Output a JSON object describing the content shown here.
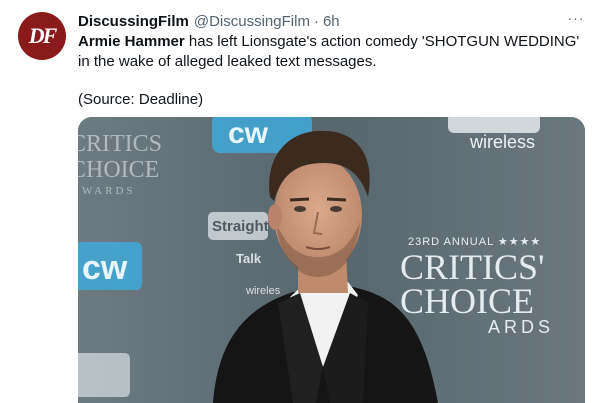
{
  "account": {
    "name": "DiscussingFilm",
    "handle": "@DiscussingFilm",
    "separator": "·",
    "time": "6h",
    "avatar_text": "DF"
  },
  "tweet": {
    "bold_name": "Armie Hammer",
    "text": " has left Lionsgate's action comedy 'SHOTGUN WEDDING' in the wake of alleged leaked text messages.",
    "source": "(Source: Deadline)"
  },
  "more_icon": "···",
  "image": {
    "backdrop_text": {
      "left_critics": "CRITICS",
      "left_choice": "CHOICE",
      "left_awards": "WARDS",
      "cw": "cw",
      "cw_top": "cw",
      "straight_talk": "Straight",
      "talk": "Talk",
      "wireless": "wireless",
      "wireless_small": "wireles",
      "annual": "23RD ANNUAL ★★★★",
      "critics": "CRITICS'",
      "choice": "CHOICE",
      "awards": "ARDS"
    }
  },
  "colors": {
    "accent": "#8b1a1a",
    "backdrop": "#5d6c73",
    "cw_blue": "#3fa9d8"
  }
}
